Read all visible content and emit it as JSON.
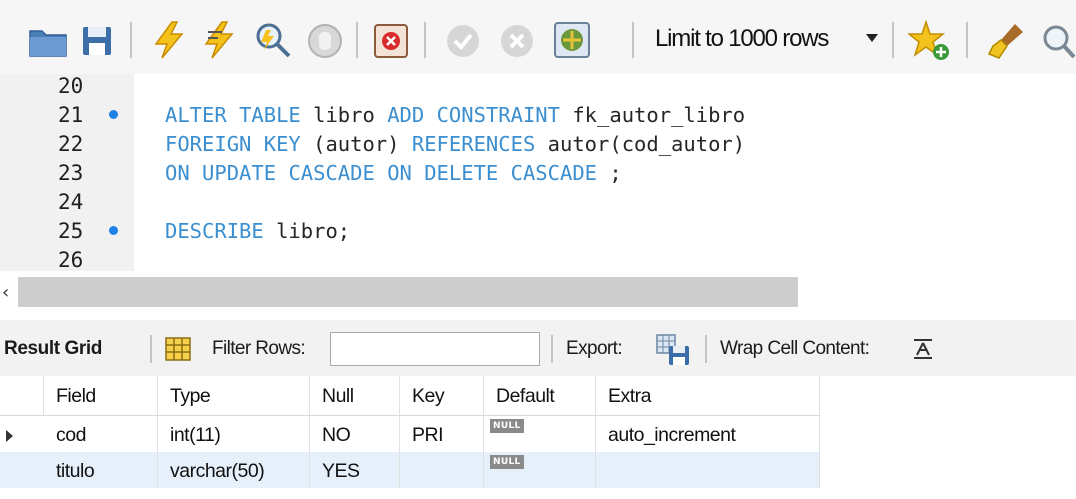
{
  "toolbar": {
    "icons": [
      "open-folder-icon",
      "save-icon",
      "execute-lightning-icon",
      "execute-current-statement-icon",
      "explain-magnifier-icon",
      "stop-icon",
      "toggle-error-continue-icon",
      "commit-icon",
      "rollback-icon",
      "autocommit-toggle-icon",
      "beautify-star-icon",
      "brush-clean-icon",
      "find-icon"
    ],
    "limit_rows": "Limit to 1000 rows"
  },
  "editor": {
    "lines": [
      {
        "num": "20",
        "marker": false,
        "code": ""
      },
      {
        "num": "21",
        "marker": true,
        "code": "ALTER TABLE libro ADD CONSTRAINT fk_autor_libro"
      },
      {
        "num": "22",
        "marker": false,
        "code": "FOREIGN KEY (autor) REFERENCES autor(cod_autor)"
      },
      {
        "num": "23",
        "marker": false,
        "code": "ON UPDATE CASCADE ON DELETE CASCADE ;"
      },
      {
        "num": "24",
        "marker": false,
        "code": ""
      },
      {
        "num": "25",
        "marker": true,
        "code": "DESCRIBE libro;"
      },
      {
        "num": "26",
        "marker": false,
        "code": ""
      }
    ],
    "keyword_color": "#3b8fd0",
    "marker_color": "#1e82e6"
  },
  "result_toolbar": {
    "result_grid_label": "Result Grid",
    "filter_rows_label": "Filter Rows:",
    "filter_value": "",
    "export_label": "Export:",
    "wrap_label": "Wrap Cell Content:"
  },
  "grid": {
    "columns": [
      "Field",
      "Type",
      "Null",
      "Key",
      "Default",
      "Extra"
    ],
    "rows": [
      {
        "Field": "cod",
        "Type": "int(11)",
        "Null": "NO",
        "Key": "PRI",
        "Default": "NULL",
        "Extra": "auto_increment",
        "selected": false,
        "pointer": true
      },
      {
        "Field": "titulo",
        "Type": "varchar(50)",
        "Null": "YES",
        "Key": "",
        "Default": "NULL",
        "Extra": "",
        "selected": true,
        "pointer": false
      }
    ],
    "selected_row_color": "#e6f0fb"
  }
}
